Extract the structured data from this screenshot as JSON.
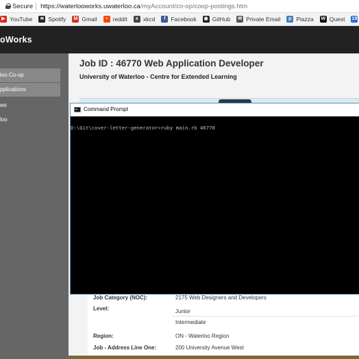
{
  "browser": {
    "security_label": "Secure",
    "url_host": "https://waterlooworks.uwaterloo.ca",
    "url_path": "/myAccount/co-op/coop-postings.htm"
  },
  "bookmarks": [
    {
      "label": "YouTube",
      "icon": "youtube-icon",
      "color": "#e62117",
      "glyph": "▶"
    },
    {
      "label": "Spotify",
      "icon": "spotify-icon",
      "color": "#222222",
      "glyph": "≋"
    },
    {
      "label": "Gmail",
      "icon": "gmail-icon",
      "color": "#d93025",
      "glyph": "M"
    },
    {
      "label": "reddit",
      "icon": "reddit-icon",
      "color": "#ff4500",
      "glyph": "•"
    },
    {
      "label": "xkcd",
      "icon": "xkcd-icon",
      "color": "#444444",
      "glyph": "x"
    },
    {
      "label": "Facebook",
      "icon": "facebook-icon",
      "color": "#3b5998",
      "glyph": "f"
    },
    {
      "label": "GitHub",
      "icon": "github-icon",
      "color": "#222222",
      "glyph": "◉"
    },
    {
      "label": "Private Email",
      "icon": "private-email-icon",
      "color": "#555555",
      "glyph": "✉"
    },
    {
      "label": "Piazza",
      "icon": "piazza-icon",
      "color": "#3e7fb6",
      "glyph": "p"
    },
    {
      "label": "Quest",
      "icon": "quest-icon",
      "color": "#111111",
      "glyph": "W"
    },
    {
      "label": "Calen",
      "icon": "calendar-icon",
      "color": "#3367d6",
      "glyph": "19"
    }
  ],
  "app": {
    "brand": "oWorks",
    "sidebar": [
      "loo Co-op",
      "pplications",
      "ws",
      "loo"
    ]
  },
  "job": {
    "title": "Job ID : 46770 Web Application Developer",
    "organization": "University of Waterloo - Centre for Extended Learning",
    "rows": [
      {
        "label": "Job Category (NOC):",
        "values": [
          "2175 Web Designers and Developers"
        ]
      },
      {
        "label": "Level:",
        "values": [
          "Junior",
          "Intermediate"
        ]
      },
      {
        "label": "Region:",
        "values": [
          "ON - Waterloo Region"
        ]
      },
      {
        "label": "Job - Address Line One:",
        "values": [
          "200 University Avenue West"
        ]
      }
    ]
  },
  "cmd": {
    "title": "Command Prompt",
    "line": "D:\\Git\\cover-letter-generator>ruby main.rb 46770"
  }
}
